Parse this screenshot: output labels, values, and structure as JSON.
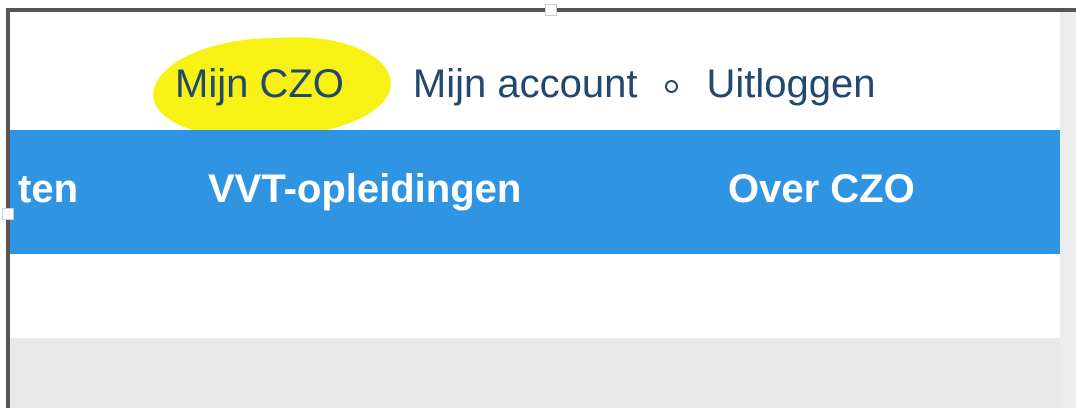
{
  "util_nav": {
    "links": [
      "Mijn CZO",
      "Mijn account",
      "Uitloggen"
    ]
  },
  "main_nav": {
    "items": [
      "ten",
      "VVT-opleidingen",
      "Over CZO"
    ]
  },
  "colors": {
    "nav_bg": "#2f94e2",
    "link": "#23486e",
    "highlight": "#f7f213"
  }
}
